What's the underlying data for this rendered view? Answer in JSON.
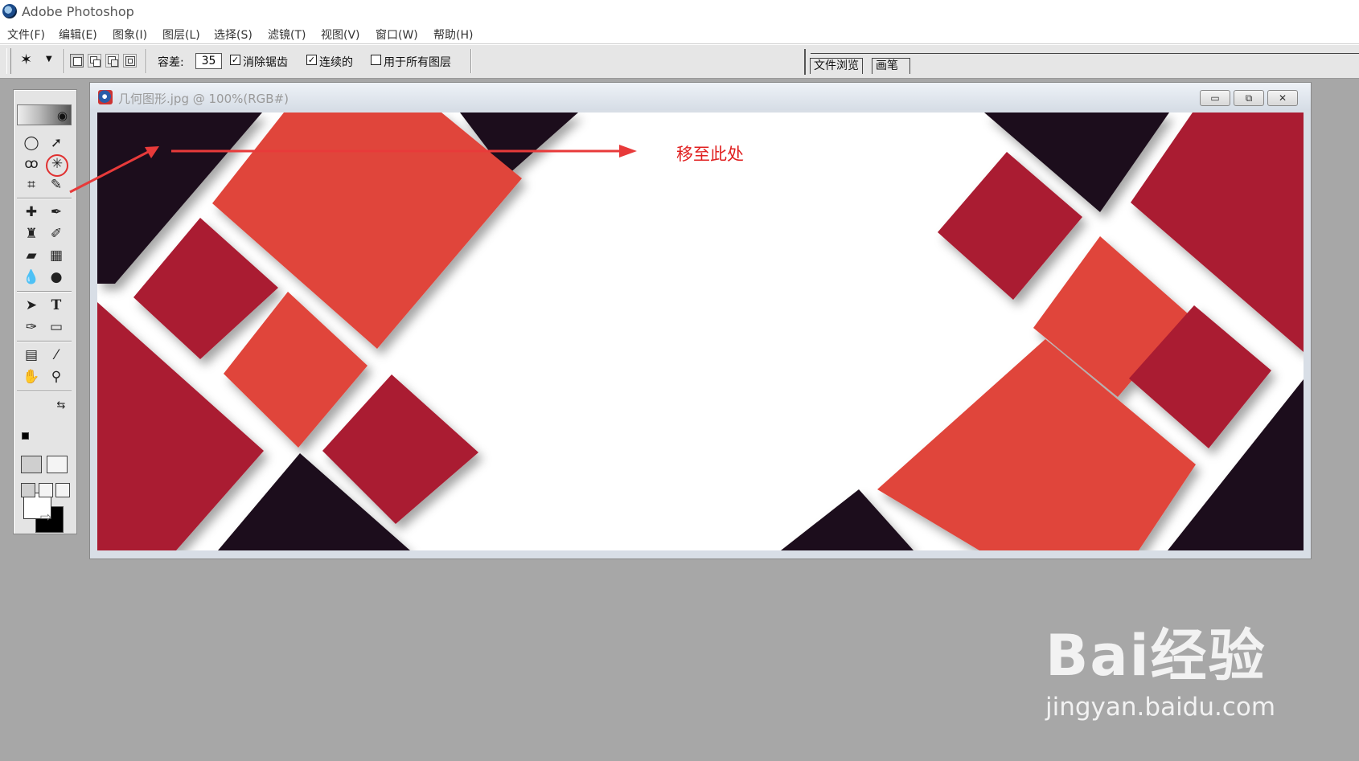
{
  "app": {
    "title": "Adobe Photoshop"
  },
  "menu": [
    "文件(F)",
    "编辑(E)",
    "图象(I)",
    "图层(L)",
    "选择(S)",
    "滤镜(T)",
    "视图(V)",
    "窗口(W)",
    "帮助(H)"
  ],
  "options": {
    "tolerance_label": "容差:",
    "tolerance_value": "35",
    "anti_alias_label": "消除锯齿",
    "anti_alias_checked": true,
    "contiguous_label": "连续的",
    "contiguous_checked": true,
    "all_layers_label": "用于所有图层",
    "all_layers_checked": false
  },
  "palette_tabs": [
    "文件浏览",
    "画笔"
  ],
  "document": {
    "title": "几何图形.jpg @ 100%(RGB#)",
    "min": "▭",
    "restore": "⧉",
    "close": "✕",
    "colors": {
      "dark": "#1c0d1a",
      "crimson": "#aa1b30",
      "red": "#e0443b",
      "white": "#ffffff"
    }
  },
  "annotation": {
    "text": "移至此处",
    "color": "#e02020"
  },
  "toolbox": {
    "active_tool": "magic-wand",
    "tools": [
      "marquee",
      "move",
      "lasso",
      "magic-wand",
      "crop",
      "slice",
      "healing",
      "brush",
      "stamp",
      "history-brush",
      "eraser",
      "gradient",
      "blur",
      "dodge",
      "path-select",
      "type",
      "pen",
      "shape",
      "notes",
      "eyedropper",
      "hand",
      "zoom"
    ]
  },
  "watermark": {
    "logo": "Bai经验",
    "url": "jingyan.baidu.com"
  }
}
